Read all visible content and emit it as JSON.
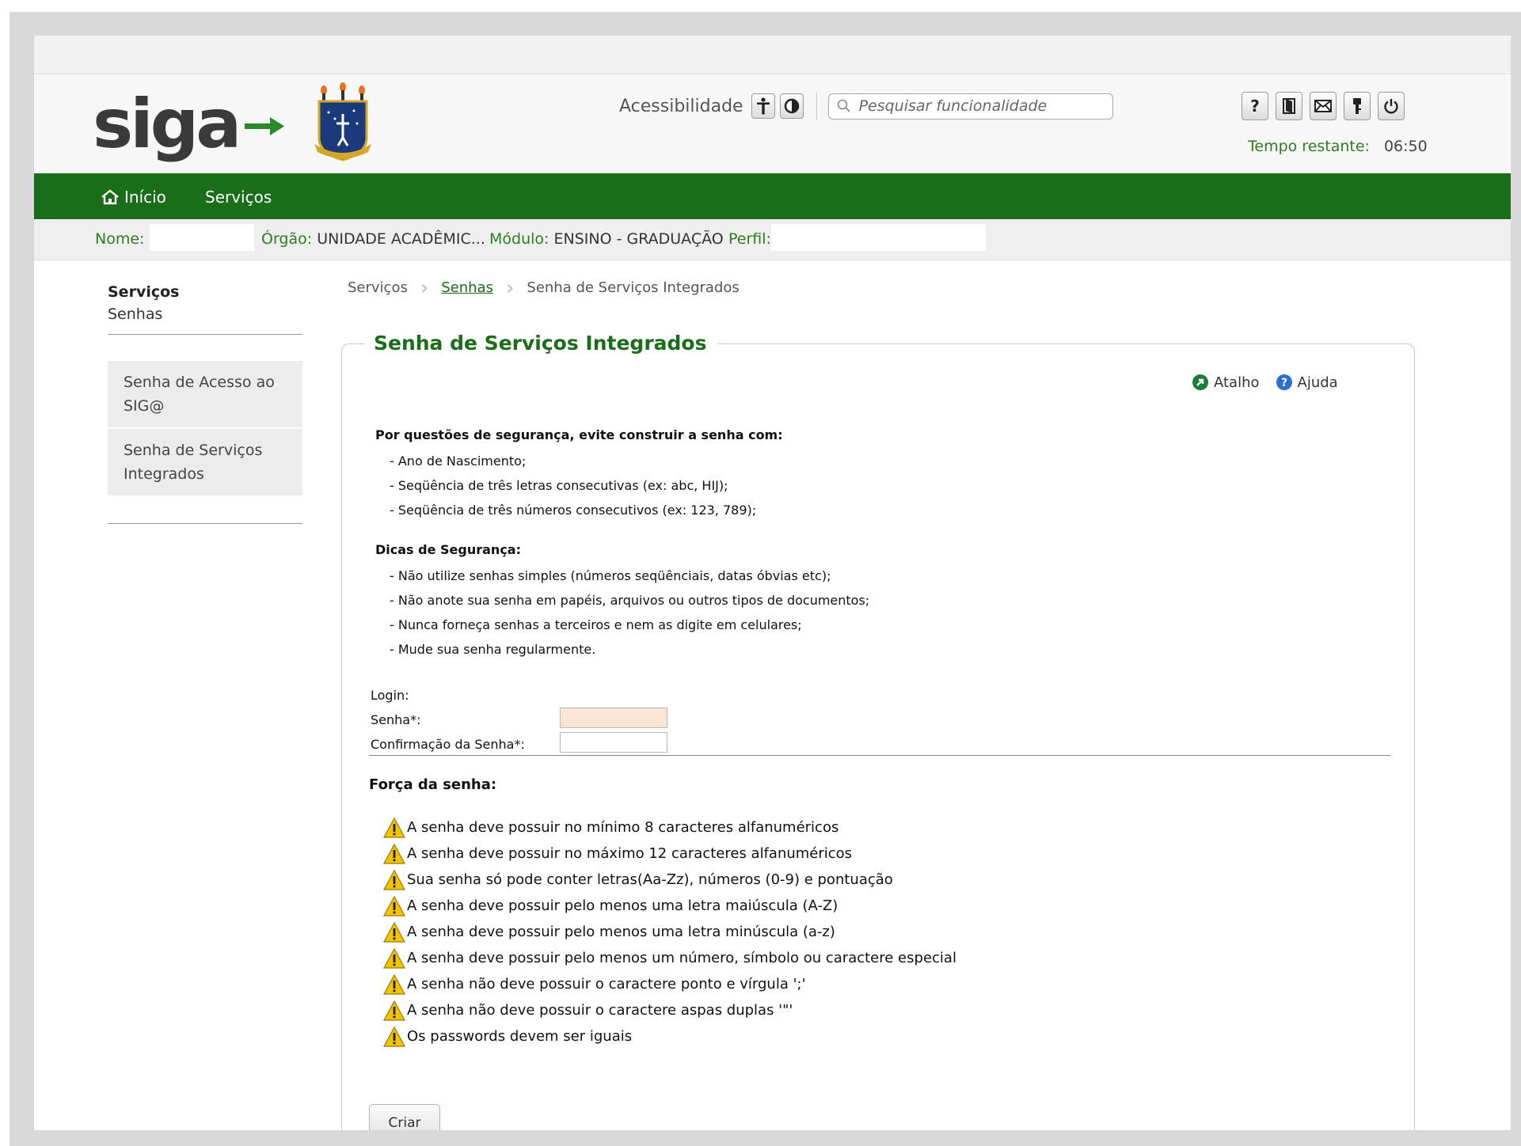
{
  "header": {
    "logo_text": "siga",
    "accessibility_label": "Acessibilidade",
    "search_placeholder": "Pesquisar funcionalidade",
    "top_icons": [
      "help-icon",
      "manual-icon",
      "mail-icon",
      "key-icon",
      "power-icon"
    ],
    "timer_label": "Tempo restante:",
    "timer_value": "06:50"
  },
  "nav": {
    "home_label": "Início",
    "services_label": "Serviços"
  },
  "infobar": {
    "nome_label": "Nome:",
    "nome_value": "",
    "orgao_label": "Órgão:",
    "orgao_value": "UNIDADE ACADÊMIC...",
    "modulo_label": "Módulo:",
    "modulo_value": "ENSINO - GRADUAÇÃO",
    "perfil_label": "Perfil:",
    "perfil_value": ""
  },
  "sidebar": {
    "title": "Serviços",
    "subtitle": "Senhas",
    "items": [
      {
        "label": "Senha de Acesso ao SIG@"
      },
      {
        "label": "Senha de Serviços Integrados"
      }
    ]
  },
  "breadcrumb": {
    "items": [
      "Serviços",
      "Senhas",
      "Senha de Serviços Integrados"
    ]
  },
  "panel": {
    "title": "Senha de Serviços Integrados",
    "shortcut_label": "Atalho",
    "help_label": "Ajuda",
    "security_heading": "Por questões de segurança, evite construir a senha com:",
    "security_items": [
      "- Ano de Nascimento;",
      "- Seqüência de três letras consecutivas (ex: abc, HIJ);",
      "- Seqüência de três números consecutivos (ex: 123, 789);"
    ],
    "tips_heading": "Dicas de Segurança:",
    "tips_items": [
      "- Não utilize senhas simples (números seqüênciais, datas óbvias etc);",
      "- Não anote sua senha em papéis, arquivos ou outros tipos de documentos;",
      "- Nunca forneça senhas a terceiros e nem as digite em celulares;",
      "- Mude sua senha regularmente."
    ]
  },
  "form": {
    "login_label": "Login:",
    "login_value": "",
    "senha_label": "Senha*:",
    "senha_value": "",
    "confirm_label": "Confirmação da Senha*:",
    "confirm_value": ""
  },
  "strength": {
    "title": "Força da senha:",
    "rules": [
      "A senha deve possuir no mínimo 8 caracteres alfanuméricos",
      "A senha deve possuir no máximo 12 caracteres alfanuméricos",
      "Sua senha só pode conter letras(Aa-Zz), números (0-9) e pontuação",
      "A senha deve possuir pelo menos uma letra maiúscula (A-Z)",
      "A senha deve possuir pelo menos uma letra minúscula (a-z)",
      "A senha deve possuir pelo menos um número, símbolo ou caractere especial",
      "A senha não deve possuir o caractere ponto e vírgula ';'",
      "A senha não deve possuir o caractere aspas duplas '\"'",
      "Os passwords devem ser iguais"
    ],
    "submit_label": "Criar"
  },
  "colors": {
    "brand_green": "#1a6e1a",
    "label_green": "#2e7d1f",
    "warning_yellow": "#f5c400",
    "active_field": "#fbe6d6"
  }
}
